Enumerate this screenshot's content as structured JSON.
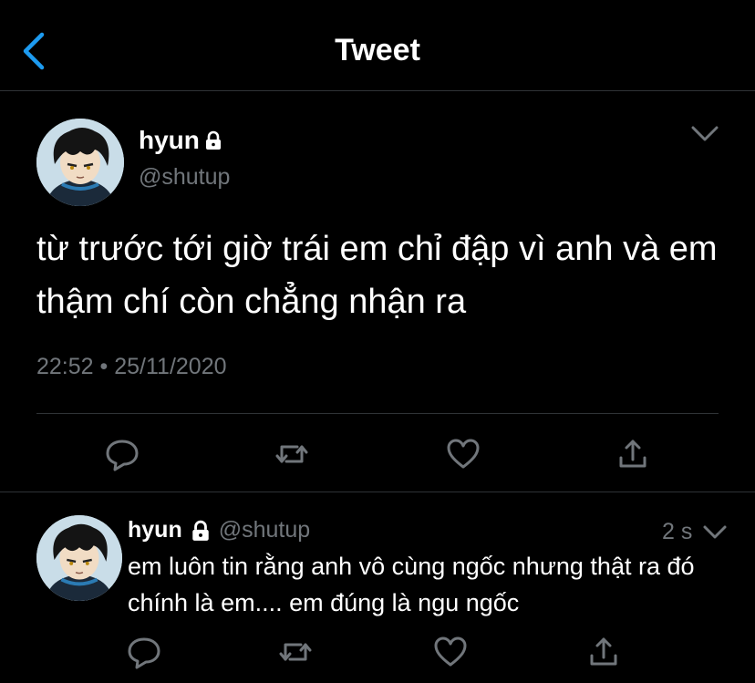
{
  "header": {
    "title": "Tweet",
    "back_icon": "chevron-left-icon",
    "accent_color": "#1d9bf0"
  },
  "main_tweet": {
    "name": "hyun",
    "handle": "@shutup",
    "locked": true,
    "text": "từ trước tới giờ trái em chỉ đập vì anh và em thậm chí còn chẳng nhận ra",
    "time": "22:52",
    "separator": "•",
    "date": "25/11/2020",
    "actions": [
      "reply-icon",
      "retweet-icon",
      "like-icon",
      "share-icon"
    ]
  },
  "reply": {
    "name": "hyun",
    "handle": "@shutup",
    "locked": true,
    "time": "2 s",
    "text": "em luôn tin rằng anh vô cùng ngốc nhưng thật ra đó chính là em.... em đúng là ngu ngốc",
    "actions": [
      "reply-icon",
      "retweet-icon",
      "like-icon",
      "share-icon"
    ]
  },
  "colors": {
    "background": "#000000",
    "text": "#ffffff",
    "secondary_text": "#71767b",
    "divider": "#2f3336"
  }
}
